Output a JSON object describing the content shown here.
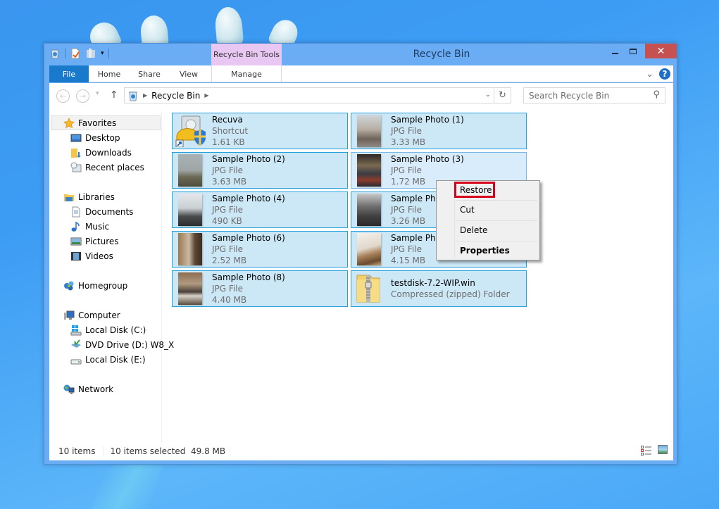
{
  "window": {
    "title": "Recycle Bin",
    "contextual_tab_group": "Recycle Bin Tools",
    "controls": {
      "minimize": "—",
      "maximize": "☐",
      "close": "✕"
    }
  },
  "ribbon": {
    "tabs": [
      {
        "label": "File"
      },
      {
        "label": "Home"
      },
      {
        "label": "Share"
      },
      {
        "label": "View"
      },
      {
        "label": "Manage"
      }
    ],
    "collapse_icon": "⌄",
    "help_icon": "?"
  },
  "navigation": {
    "back_icon": "←",
    "forward_icon": "→",
    "recent_icon": "▾",
    "up_icon": "↑",
    "breadcrumb": [
      "Recycle Bin"
    ],
    "refresh_icon": "↻",
    "dropdown_icon": "⌄",
    "search_placeholder": "Search Recycle Bin",
    "search_icon": "⚲"
  },
  "sidebar": {
    "items": [
      {
        "label": "Favorites",
        "icon": "star-icon",
        "level": 0,
        "highlighted": true
      },
      {
        "label": "Desktop",
        "icon": "desktop-icon",
        "level": 1
      },
      {
        "label": "Downloads",
        "icon": "downloads-icon",
        "level": 1
      },
      {
        "label": "Recent places",
        "icon": "recent-places-icon",
        "level": 1
      },
      {
        "label": "Libraries",
        "icon": "libraries-icon",
        "level": 0
      },
      {
        "label": "Documents",
        "icon": "documents-icon",
        "level": 1
      },
      {
        "label": "Music",
        "icon": "music-icon",
        "level": 1
      },
      {
        "label": "Pictures",
        "icon": "pictures-icon",
        "level": 1
      },
      {
        "label": "Videos",
        "icon": "videos-icon",
        "level": 1
      },
      {
        "label": "Homegroup",
        "icon": "homegroup-icon",
        "level": 0
      },
      {
        "label": "Computer",
        "icon": "computer-icon",
        "level": 0
      },
      {
        "label": "Local Disk (C:)",
        "icon": "system-drive-icon",
        "level": 1
      },
      {
        "label": "DVD Drive (D:) W8_X",
        "icon": "dvd-drive-icon",
        "level": 1
      },
      {
        "label": "Local Disk (E:)",
        "icon": "drive-icon",
        "level": 1
      },
      {
        "label": "Network",
        "icon": "network-icon",
        "level": 0
      }
    ]
  },
  "files": [
    {
      "name": "Recuva",
      "type": "Shortcut",
      "size": "1.61 KB",
      "icon": "recuva-shortcut-icon"
    },
    {
      "name": "Sample Photo (1)",
      "type": "JPG File",
      "size": "3.33 MB",
      "icon": "photo-thumbnail"
    },
    {
      "name": "Sample Photo (2)",
      "type": "JPG File",
      "size": "3.63 MB",
      "icon": "photo-thumbnail"
    },
    {
      "name": "Sample Photo (3)",
      "type": "JPG File",
      "size": "1.72 MB",
      "icon": "photo-thumbnail"
    },
    {
      "name": "Sample Photo (4)",
      "type": "JPG File",
      "size": "490 KB",
      "icon": "photo-thumbnail"
    },
    {
      "name": "Sample Photo (5)",
      "type": "JPG File",
      "size": "3.26 MB",
      "icon": "photo-thumbnail"
    },
    {
      "name": "Sample Photo (6)",
      "type": "JPG File",
      "size": "2.52 MB",
      "icon": "photo-thumbnail"
    },
    {
      "name": "Sample Photo (7)",
      "type": "JPG File",
      "size": "4.15 MB",
      "icon": "photo-thumbnail"
    },
    {
      "name": "Sample Photo (8)",
      "type": "JPG File",
      "size": "4.40 MB",
      "icon": "photo-thumbnail"
    },
    {
      "name": "testdisk-7.2-WIP.win",
      "type": "Compressed (zipped) Folder",
      "size": "",
      "icon": "zip-folder-icon"
    }
  ],
  "context_menu": {
    "items": [
      {
        "label": "Restore",
        "highlighted": true
      },
      {
        "label": "Cut"
      },
      {
        "label": "Delete"
      },
      {
        "label": "Properties",
        "bold": true
      }
    ]
  },
  "status": {
    "item_count": "10 items",
    "selection": "10 items selected  49.8 MB"
  },
  "colors": {
    "selection_fill": "#cce8f6",
    "selection_border": "#26a0da",
    "file_tab": "#1979ca",
    "contextual_tab": "#e8c8f3",
    "close_button": "#c75050",
    "restore_highlight": "#d6001c"
  }
}
